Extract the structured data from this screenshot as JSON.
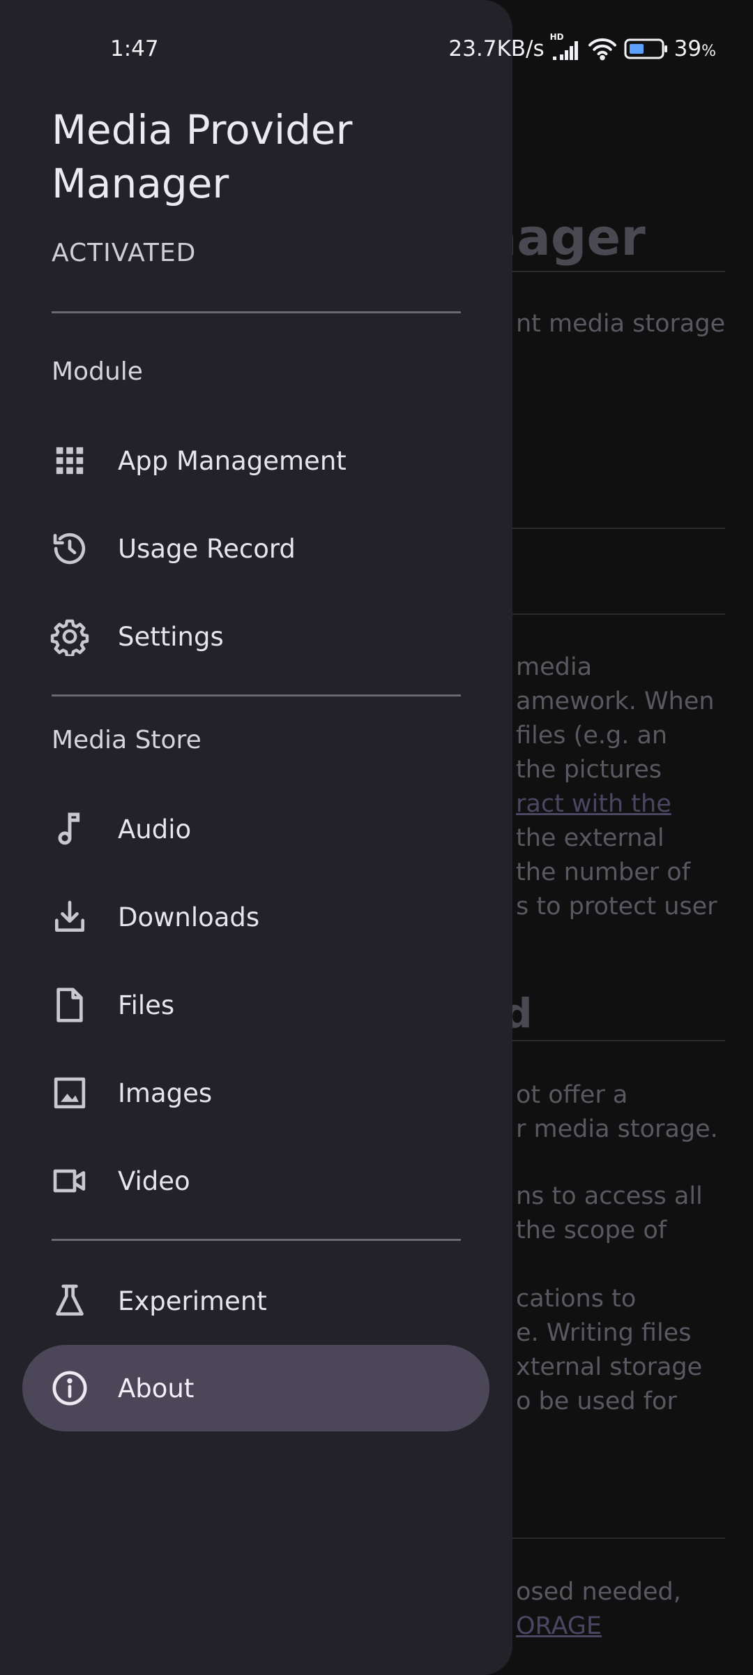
{
  "status_bar": {
    "time": "1:47",
    "network_speed": "23.7KB/s",
    "signal_badge": "HD",
    "battery_percent": "39",
    "battery_unit": "%"
  },
  "drawer": {
    "app_title": "Media Provider Manager",
    "app_status": "ACTIVATED",
    "sections": {
      "module": "Module",
      "media_store": "Media Store"
    },
    "items": {
      "app_management": "App Management",
      "usage_record": "Usage Record",
      "settings": "Settings",
      "audio": "Audio",
      "downloads": "Downloads",
      "files": "Files",
      "images": "Images",
      "video": "Video",
      "experiment": "Experiment",
      "about": "About"
    },
    "selected_item": "about"
  },
  "background": {
    "title_fragment": "nager",
    "line_1": "nt media storage",
    "para_1": [
      "media",
      "amework. When",
      "files (e.g. an",
      "the pictures",
      "ract with the",
      "the external",
      "the number of",
      "s to protect user"
    ],
    "heading_fragment": "d",
    "para_2": [
      "ot offer a",
      "r media storage."
    ],
    "para_3": [
      "ns to access all",
      "the scope of"
    ],
    "para_4": [
      "cations to",
      "e. Writing files",
      "xternal storage",
      "o be used for"
    ],
    "para_5_a": "osed needed,",
    "para_5_link": "ORAGE"
  },
  "colors": {
    "drawer_bg": "#232228",
    "active_bg": "#4b4758",
    "link": "#4d4663"
  }
}
